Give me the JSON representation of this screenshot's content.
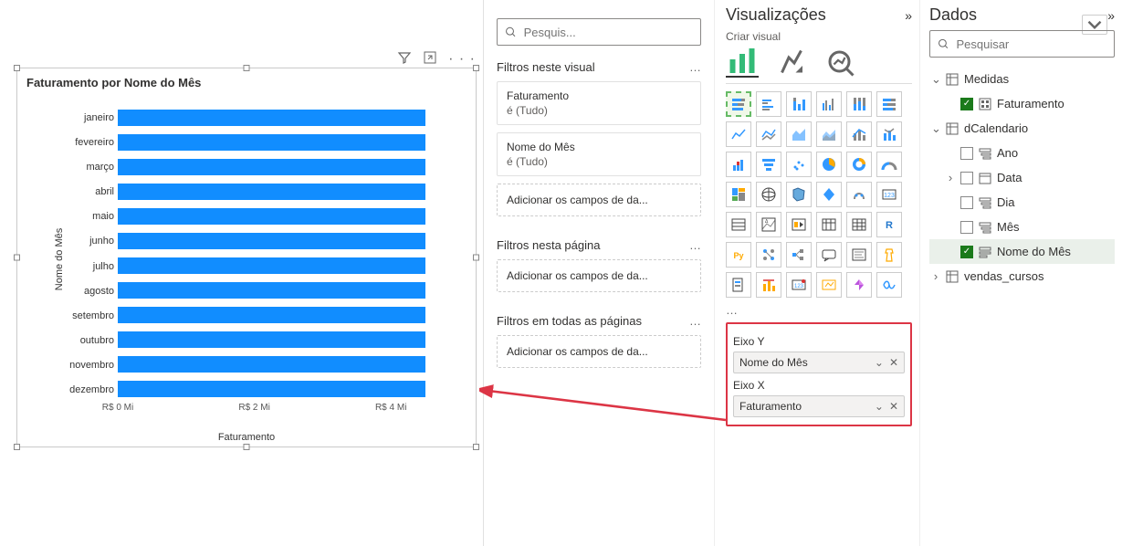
{
  "canvas": {
    "title": "Faturamento por Nome do Mês",
    "y_axis_title": "Nome do Mês",
    "x_axis_title": "Faturamento",
    "x_ticks": [
      "R$ 0 Mi",
      "R$ 2 Mi",
      "R$ 4 Mi"
    ]
  },
  "chart_data": {
    "type": "bar",
    "orientation": "horizontal",
    "title": "Faturamento por Nome do Mês",
    "xlabel": "Faturamento",
    "ylabel": "Nome do Mês",
    "x_ticks": [
      "R$ 0 Mi",
      "R$ 2 Mi",
      "R$ 4 Mi"
    ],
    "xlim_mi": [
      0,
      5
    ],
    "categories": [
      "janeiro",
      "fevereiro",
      "março",
      "abril",
      "maio",
      "junho",
      "julho",
      "agosto",
      "setembro",
      "outubro",
      "novembro",
      "dezembro"
    ],
    "values_mi_reais": [
      4.5,
      4.5,
      4.5,
      4.5,
      4.5,
      4.5,
      4.5,
      4.5,
      4.5,
      4.5,
      4.5,
      4.5
    ],
    "bar_color": "#118DFF"
  },
  "filters": {
    "search_placeholder": "Pesquis...",
    "sections": {
      "visual": {
        "title": "Filtros neste visual",
        "cards": [
          {
            "title": "Faturamento",
            "sub": "é (Tudo)"
          },
          {
            "title": "Nome do Mês",
            "sub": "é (Tudo)"
          }
        ],
        "add": "Adicionar os campos de da..."
      },
      "page": {
        "title": "Filtros nesta página",
        "add": "Adicionar os campos de da..."
      },
      "all": {
        "title": "Filtros em todas as páginas",
        "add": "Adicionar os campos de da..."
      }
    }
  },
  "viz": {
    "header": "Visualizações",
    "subtitle": "Criar visual",
    "field_wells": {
      "y_label": "Eixo Y",
      "y_value": "Nome do Mês",
      "x_label": "Eixo X",
      "x_value": "Faturamento"
    }
  },
  "data": {
    "header": "Dados",
    "search_placeholder": "Pesquisar",
    "tables": [
      {
        "name": "Medidas",
        "expanded": true,
        "fields": [
          {
            "name": "Faturamento",
            "checked": true,
            "icon": "measure"
          }
        ]
      },
      {
        "name": "dCalendario",
        "expanded": true,
        "fields": [
          {
            "name": "Ano",
            "checked": false,
            "icon": "hier"
          },
          {
            "name": "Data",
            "checked": false,
            "icon": "date",
            "expandable": true
          },
          {
            "name": "Dia",
            "checked": false,
            "icon": "hier"
          },
          {
            "name": "Mês",
            "checked": false,
            "icon": "hier"
          },
          {
            "name": "Nome do Mês",
            "checked": true,
            "icon": "text",
            "selected": true
          }
        ]
      },
      {
        "name": "vendas_cursos",
        "expanded": false,
        "fields": []
      }
    ]
  }
}
